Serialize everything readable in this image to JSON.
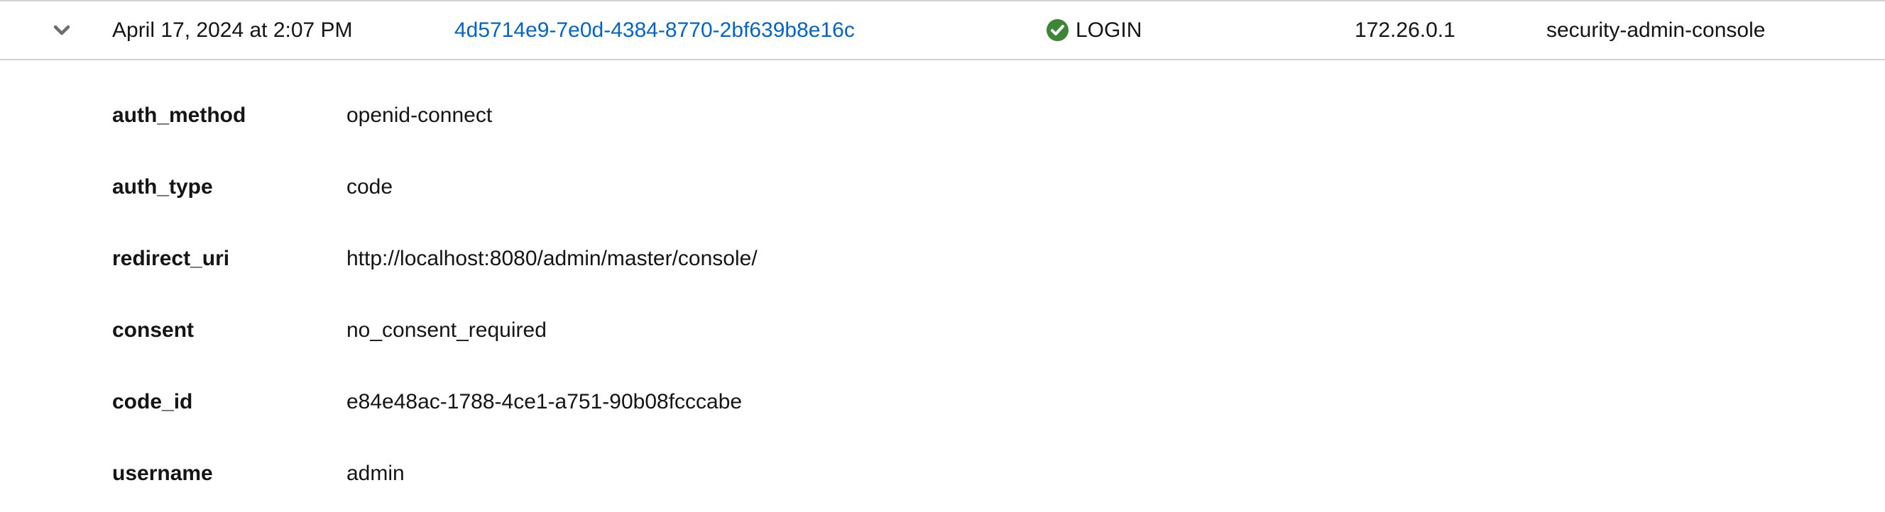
{
  "event": {
    "expanded": true,
    "time": "April 17, 2024 at 2:07 PM",
    "user_id": "4d5714e9-7e0d-4384-8770-2bf639b8e16c",
    "event_type": "LOGIN",
    "status": "success",
    "ip_address": "172.26.0.1",
    "client": "security-admin-console",
    "colors": {
      "link": "#0066cc",
      "success": "#3e8635",
      "text": "#151515",
      "border": "#d2d2d2"
    },
    "icons": {
      "toggle": "chevron-down-icon",
      "status": "check-circle-icon"
    },
    "details": [
      {
        "key": "auth_method",
        "value": "openid-connect"
      },
      {
        "key": "auth_type",
        "value": "code"
      },
      {
        "key": "redirect_uri",
        "value": "http://localhost:8080/admin/master/console/"
      },
      {
        "key": "consent",
        "value": "no_consent_required"
      },
      {
        "key": "code_id",
        "value": "e84e48ac-1788-4ce1-a751-90b08fcccabe"
      },
      {
        "key": "username",
        "value": "admin"
      }
    ]
  }
}
